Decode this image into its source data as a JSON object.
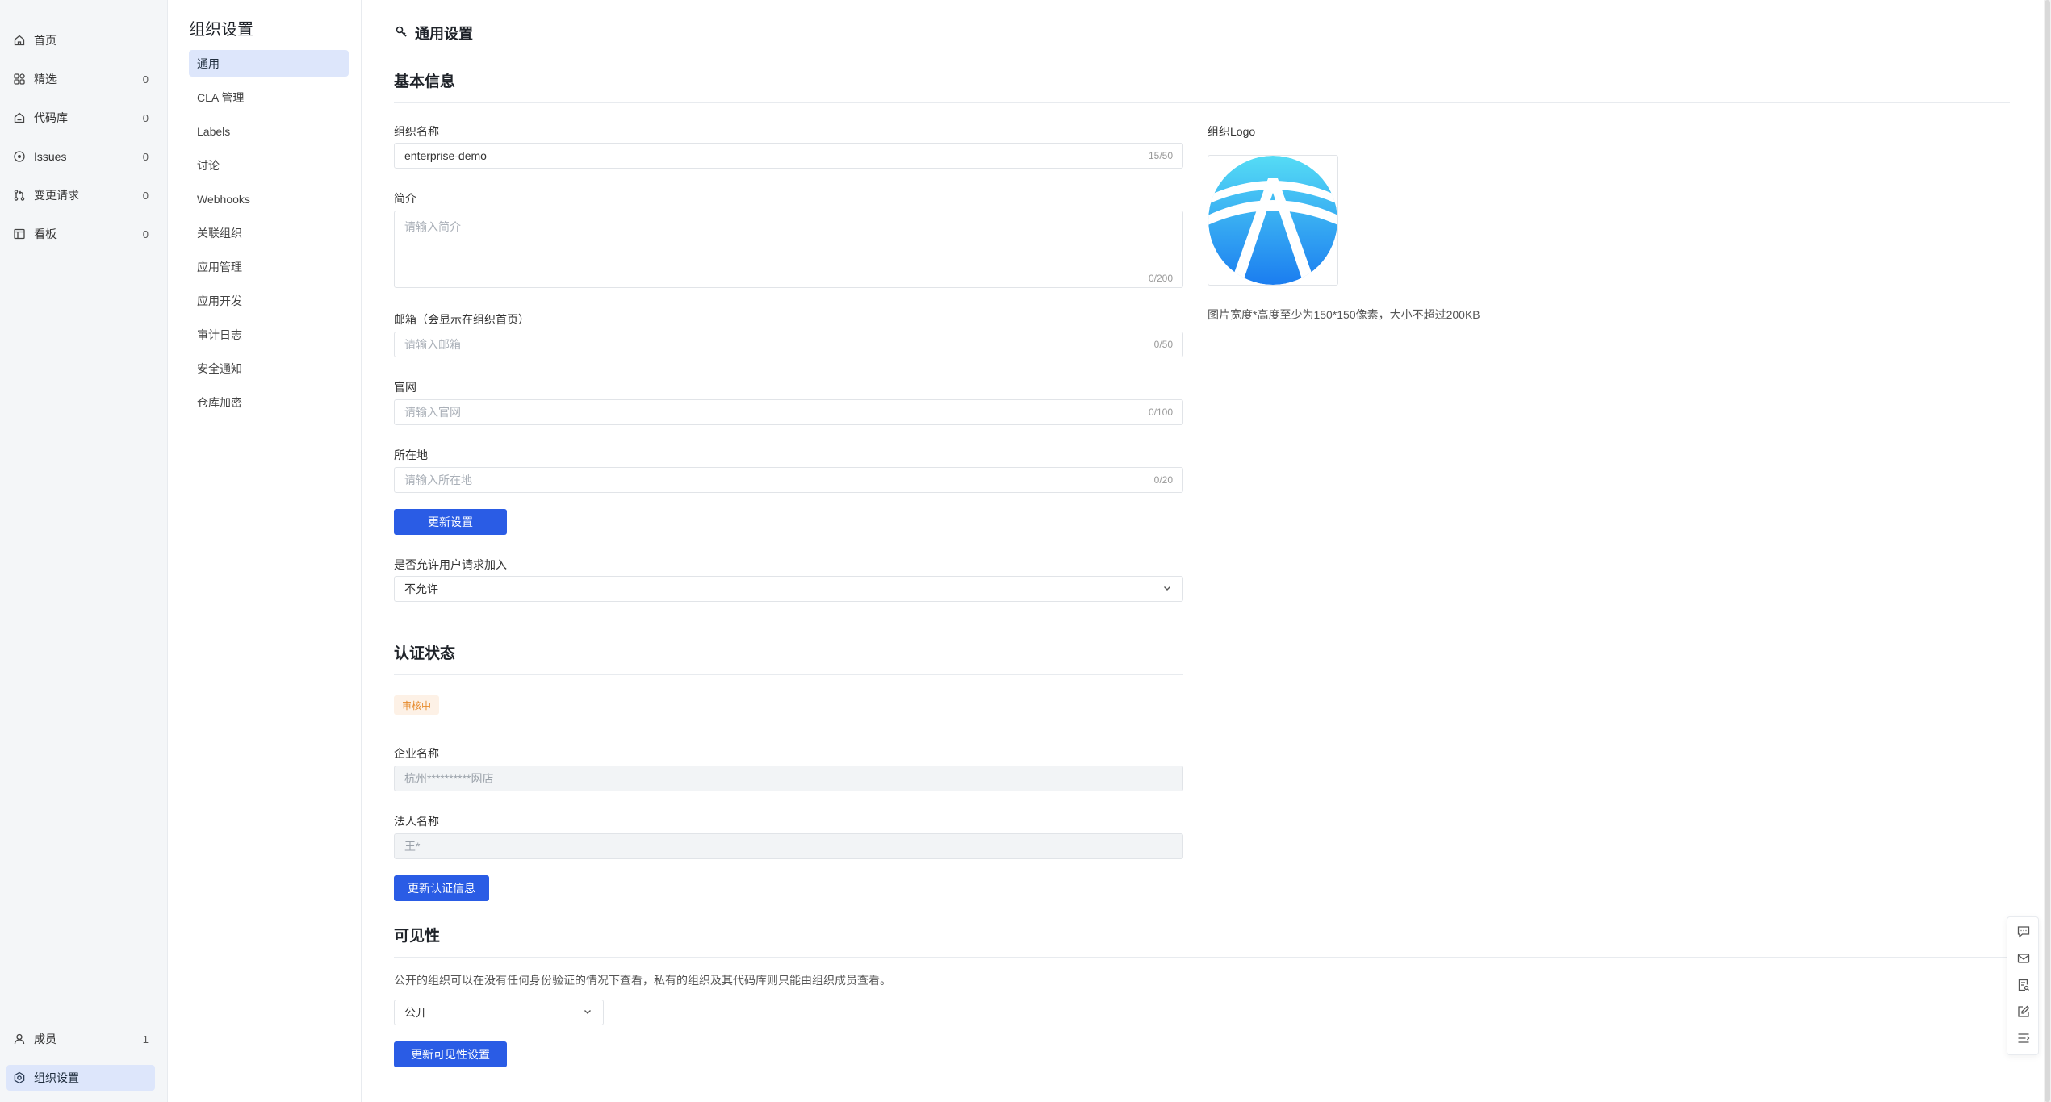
{
  "leftnav": {
    "items": [
      {
        "label": "首页",
        "count": "",
        "icon": "home-icon"
      },
      {
        "label": "精选",
        "count": "0",
        "icon": "grid-icon"
      },
      {
        "label": "代码库",
        "count": "0",
        "icon": "repo-icon"
      },
      {
        "label": "Issues",
        "count": "0",
        "icon": "issue-icon"
      },
      {
        "label": "变更请求",
        "count": "0",
        "icon": "pull-request-icon"
      },
      {
        "label": "看板",
        "count": "0",
        "icon": "board-icon"
      }
    ],
    "bottom": [
      {
        "label": "成员",
        "count": "1",
        "icon": "user-icon"
      },
      {
        "label": "组织设置",
        "count": "",
        "icon": "settings-icon"
      }
    ]
  },
  "subnav": {
    "title": "组织设置",
    "items": [
      "通用",
      "CLA 管理",
      "Labels",
      "讨论",
      "Webhooks",
      "关联组织",
      "应用管理",
      "应用开发",
      "审计日志",
      "安全通知",
      "仓库加密"
    ]
  },
  "main": {
    "page_title": "通用设置",
    "basic": {
      "title": "基本信息",
      "name_label": "组织名称",
      "name_value": "enterprise-demo",
      "name_counter": "15/50",
      "intro_label": "简介",
      "intro_placeholder": "请输入简介",
      "intro_counter": "0/200",
      "email_label": "邮箱（会显示在组织首页）",
      "email_placeholder": "请输入邮箱",
      "email_counter": "0/50",
      "site_label": "官网",
      "site_placeholder": "请输入官网",
      "site_counter": "0/100",
      "location_label": "所在地",
      "location_placeholder": "请输入所在地",
      "location_counter": "0/20",
      "update_button": "更新设置",
      "allow_join_label": "是否允许用户请求加入",
      "allow_join_value": "不允许"
    },
    "logo": {
      "label": "组织Logo",
      "hint": "图片宽度*高度至少为150*150像素，大小不超过200KB"
    },
    "cert": {
      "title": "认证状态",
      "status": "审核中",
      "company_label": "企业名称",
      "company_value": "杭州**********网店",
      "legal_label": "法人名称",
      "legal_value": "王*",
      "update_button": "更新认证信息"
    },
    "visibility": {
      "title": "可见性",
      "desc": "公开的组织可以在没有任何身份验证的情况下查看，私有的组织及其代码库则只能由组织成员查看。",
      "value": "公开",
      "update_button": "更新可见性设置"
    }
  },
  "colors": {
    "primary": "#2a5ce5",
    "active_bg": "#dde6fb",
    "badge_text": "#e68b2d",
    "badge_bg": "#fdf1e6"
  }
}
